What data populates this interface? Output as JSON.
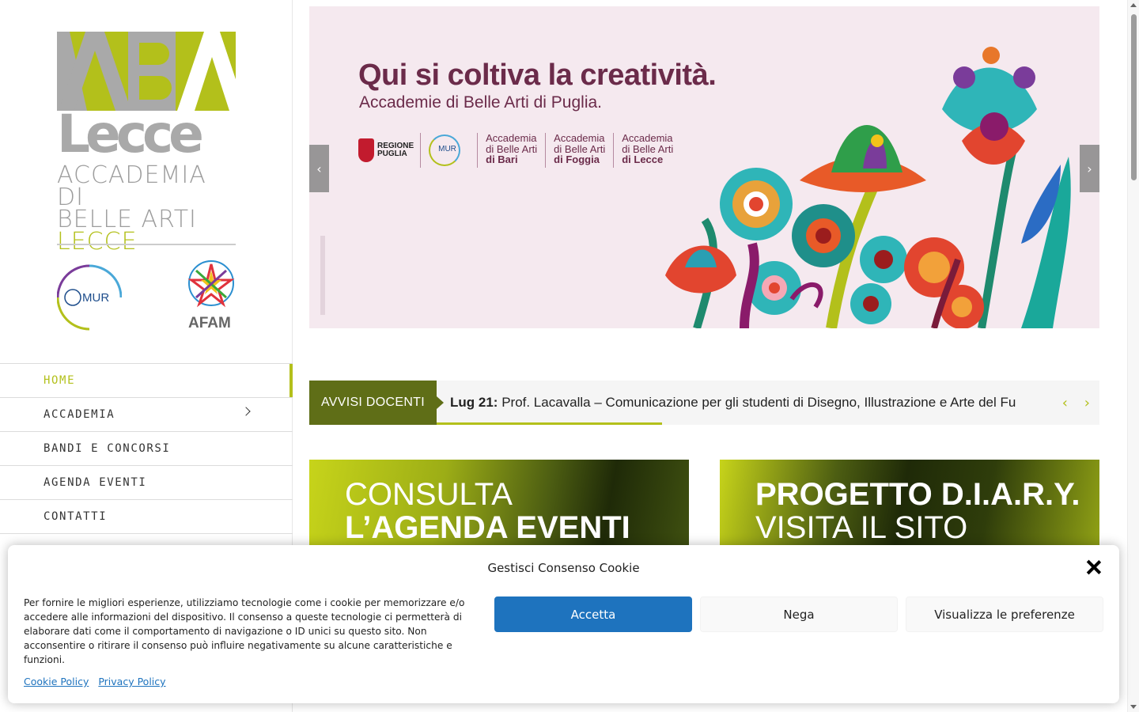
{
  "logo": {
    "top_letters": "ABA",
    "bottom_word": "Lecce",
    "sub_line1": "ACCADEMIA DI",
    "sub_line2": "BELLE ARTI",
    "sub_line3": "LECCE",
    "mur_label": "MUR",
    "afam_label": "AFAM"
  },
  "menu": {
    "items": [
      {
        "label": "HOME",
        "active": true
      },
      {
        "label": "ACCADEMIA",
        "has_submenu": true
      },
      {
        "label": "BANDI E CONCORSI"
      },
      {
        "label": "AGENDA EVENTI"
      },
      {
        "label": "CONTATTI"
      }
    ]
  },
  "hero": {
    "title": "Qui si coltiva la creatività.",
    "subtitle": "Accademie di Belle Arti di Puglia.",
    "region_label_1": "REGIONE",
    "region_label_2": "PUGLIA",
    "mur_label": "MUR",
    "acc_bari_1": "Accademia",
    "acc_bari_2": "di Belle Arti",
    "acc_bari_3": "di Bari",
    "acc_foggia_1": "Accademia",
    "acc_foggia_2": "di Belle Arti",
    "acc_foggia_3": "di Foggia",
    "acc_lecce_1": "Accademia",
    "acc_lecce_2": "di Belle Arti",
    "acc_lecce_3": "di Lecce",
    "prev_arrow": "‹",
    "next_arrow": "›"
  },
  "ticker": {
    "label": "AVVISI DOCENTI",
    "date": "Lug 21:",
    "text": "Prof. Lacavalla – Comunicazione per gli studenti di Disegno, Illustrazione e Arte del Fu",
    "prev": "‹",
    "next": "›",
    "progress": 0.34
  },
  "promos": [
    {
      "line1": "CONSULTA",
      "line2": "L’AGENDA EVENTI"
    },
    {
      "line1": "PROGETTO D.I.A.R.Y.",
      "line2": "VISITA IL SITO"
    }
  ],
  "cookie": {
    "title": "Gestisci Consenso Cookie",
    "body": "Per fornire le migliori esperienze, utilizziamo tecnologie come i cookie per memorizzare e/o accedere alle informazioni del dispositivo. Il consenso a queste tecnologie ci permetterà di elaborare dati come il comportamento di navigazione o ID unici su questo sito. Non acconsentire o ritirare il consenso può influire negativamente su alcune caratteristiche e funzioni.",
    "accept": "Accetta",
    "deny": "Nega",
    "preferences": "Visualizza le preferenze",
    "cookie_policy": "Cookie Policy",
    "privacy_policy": "Privacy Policy"
  },
  "colors": {
    "brand_green": "#b3c01b",
    "dark_green": "#5f6e17",
    "hero_purple": "#6b2b4a",
    "accept_blue": "#1e73be"
  }
}
